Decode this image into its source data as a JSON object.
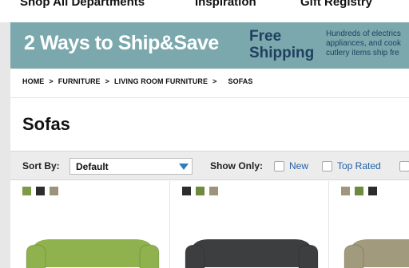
{
  "topnav": {
    "items": [
      {
        "label": "Shop All Departments"
      },
      {
        "label": "Inspiration"
      },
      {
        "label": "Gift Registry"
      }
    ]
  },
  "banner": {
    "headline": "2 Ways to Ship&Save",
    "free_line1": "Free",
    "free_line2": "Shipping",
    "copy_line1": "Hundreds of electrics",
    "copy_line2": "appliances, and cook",
    "copy_line3": "cutlery items ship fre"
  },
  "breadcrumb": {
    "items": [
      "HOME",
      "FURNITURE",
      "LIVING ROOM FURNITURE",
      "SOFAS"
    ],
    "separator": ">"
  },
  "page": {
    "title": "Sofas"
  },
  "sortbar": {
    "sort_label": "Sort By:",
    "sort_value": "Default",
    "show_label": "Show Only:",
    "filters": [
      {
        "label": "New",
        "checked": false
      },
      {
        "label": "Top Rated",
        "checked": false
      }
    ]
  },
  "products": [
    {
      "swatches": [
        "#7f9a47",
        "#2c2d2f",
        "#9c9479"
      ],
      "sofa_color": "#8fb24e"
    },
    {
      "swatches": [
        "#2b2c2e",
        "#6f8a3f",
        "#9d9578"
      ],
      "sofa_color": "#3d3e40"
    },
    {
      "swatches": [
        "#a09679",
        "#6d8a3e",
        "#2b2c2e"
      ],
      "sofa_color": "#a29a7c"
    }
  ],
  "colors": {
    "banner_bg": "#7aa8ad",
    "banner_headline": "#ffffff",
    "banner_accent": "#1f3f5e",
    "link_blue": "#1f5fa8",
    "select_arrow": "#2a7fc1"
  }
}
